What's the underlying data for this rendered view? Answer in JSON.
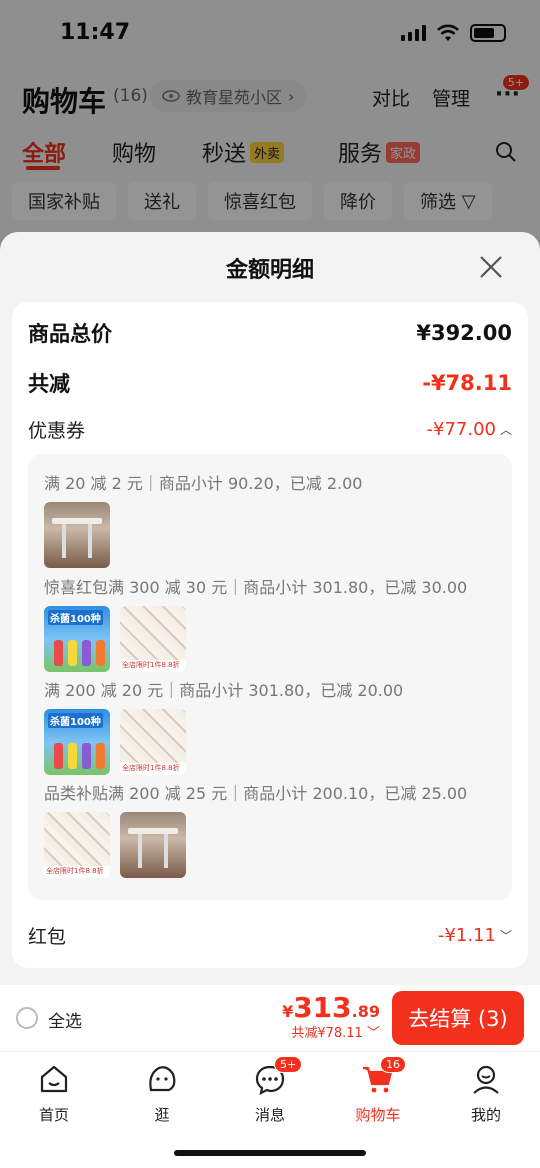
{
  "status": {
    "time": "11:47"
  },
  "header": {
    "title": "购物车",
    "count": "(16)",
    "location": "教育星苑小区",
    "compare": "对比",
    "manage": "管理",
    "more_badge": "5+"
  },
  "tabs": [
    {
      "label": "全部"
    },
    {
      "label": "购物"
    },
    {
      "label": "秒送",
      "tag": "外卖"
    },
    {
      "label": "服务",
      "tag": "家政"
    }
  ],
  "chips": [
    "国家补贴",
    "送礼",
    "惊喜红包",
    "降价",
    "筛选"
  ],
  "sheet": {
    "title": "金额明细",
    "total_label": "商品总价",
    "total_value": "¥392.00",
    "discount_label": "共减",
    "discount_value": "-¥78.11",
    "coupon_label": "优惠券",
    "coupon_value": "-¥77.00",
    "coupon_groups": [
      {
        "text": "满 20 减 2 元｜商品小计 90.20，已减 2.00"
      },
      {
        "text": "惊喜红包满 300 减 30 元｜商品小计 301.80，已减 30.00"
      },
      {
        "text": "满 200 减 20 元｜商品小计 301.80，已减 20.00"
      },
      {
        "text": "品类补贴满 200 减 25 元｜商品小计 200.10，已减 25.00"
      }
    ],
    "thumb_texts": {
      "cleaner_title": "杀菌100种",
      "quilt_label": "全店限时1件8.8折"
    },
    "redpacket_label": "红包",
    "redpacket_value": "-¥1.11"
  },
  "checkout": {
    "select_all": "全选",
    "currency": "¥",
    "amount_int": "313",
    "amount_dec": ".89",
    "saved": "共减¥78.11",
    "button": "去结算 (3)"
  },
  "tabbar": [
    {
      "label": "首页",
      "icon": "home-icon"
    },
    {
      "label": "逛",
      "icon": "browse-icon"
    },
    {
      "label": "消息",
      "icon": "message-icon",
      "badge": "5+"
    },
    {
      "label": "购物车",
      "icon": "cart-icon",
      "badge": "16"
    },
    {
      "label": "我的",
      "icon": "profile-icon"
    }
  ],
  "colors": {
    "accent": "#f2301c",
    "overlay": "rgba(0,0,0,0.42)"
  }
}
